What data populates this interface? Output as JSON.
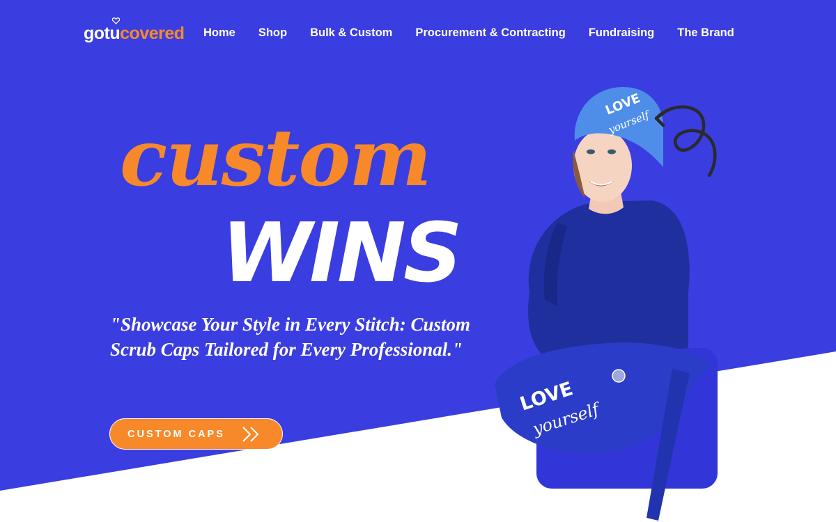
{
  "brand": {
    "logo_got": "got",
    "logo_u": "u",
    "logo_covered": "covered"
  },
  "nav": {
    "items": [
      {
        "label": "Home"
      },
      {
        "label": "Shop"
      },
      {
        "label": "Bulk & Custom"
      },
      {
        "label": "Procurement & Contracting"
      },
      {
        "label": "Fundraising"
      },
      {
        "label": "The Brand"
      }
    ]
  },
  "hero": {
    "headline_script": "custom",
    "headline_bold": "WINS",
    "tagline": "\"Showcase Your Style in Every Stitch: Custom Scrub Caps Tailored for Every Professional.\"",
    "cta_label": "CUSTOM CAPS",
    "cap_text_top": "LOVE",
    "cap_text_script": "yourself"
  },
  "colors": {
    "primary_blue": "#3a3de0",
    "accent_orange": "#f7892a",
    "white": "#ffffff",
    "scrub_navy": "#1f2f9e",
    "cap_light_blue": "#4f8ee8"
  },
  "icons": {
    "cta_icon": "double-chevron-right-icon",
    "heart_icon": "heart-icon",
    "arrow_icon": "curly-arrow-icon"
  }
}
